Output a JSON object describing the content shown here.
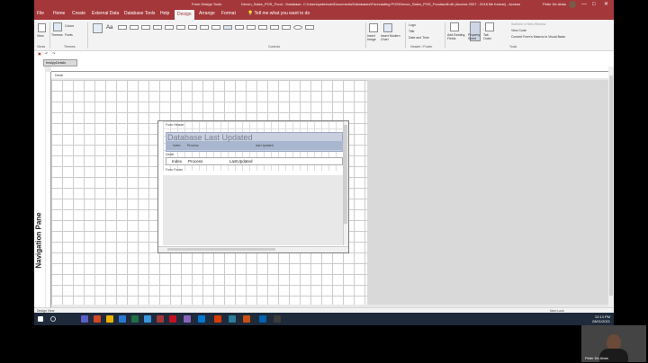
{
  "titlebar": {
    "context": "Form Design Tools",
    "title": "Devon_Sales_POS_Food - Database- C:\\Users\\petes\\ain\\Documents\\Databases\\Forecasting POS\\Devon_Sales_POS_Foodaudit.db (Access 2007 - 2016 file format) - Access",
    "user": "Peter De Alwis",
    "minimize": "—",
    "maximize": "□",
    "close": "✕"
  },
  "tabs": [
    "File",
    "Home",
    "Create",
    "External Data",
    "Database Tools",
    "Help",
    "Design",
    "Arrange",
    "Format"
  ],
  "active_tab": "Design",
  "tellme": "Tell me what you want to do",
  "ribbon": {
    "groups": [
      "Views",
      "Themes",
      "Controls",
      "Header / Footer",
      "Tools"
    ],
    "items": {
      "view": "View",
      "themes": "Themes",
      "colors": "Colors",
      "fonts": "Fonts",
      "insert_image": "Insert Image",
      "insert_modern_chart": "Insert Modern Chart",
      "logo": "Logo",
      "title": "Title",
      "date_time": "Date and Time",
      "add_existing_fields": "Add Existing Fields",
      "property_sheet": "Property Sheet",
      "tab_order": "Tab Order",
      "subform_new_window": "Subform in New Window",
      "view_code": "View Code",
      "convert_macros": "Convert Form's Macros to Visual Basic"
    }
  },
  "document_tab": "frmAppDetails",
  "nav_pane": "Navigation Pane",
  "sections": {
    "detail": "Detail",
    "form_header": "Form Header",
    "detail_inner": "Detail",
    "form_footer": "Form Footer"
  },
  "subform": {
    "title": "Database Last Updated",
    "columns": [
      "Index",
      "Process",
      "last Updated"
    ],
    "row": [
      "Index",
      "Process",
      "LastUpdated"
    ]
  },
  "status": {
    "left": "Design View",
    "right": "Num Lock"
  },
  "clock": {
    "time": "12:14 PM",
    "date": "28/01/2021"
  },
  "video": {
    "name": "Peter De Alwis"
  },
  "colors": {
    "accent": "#a4373a",
    "taskbar": "#1f2a3a"
  }
}
